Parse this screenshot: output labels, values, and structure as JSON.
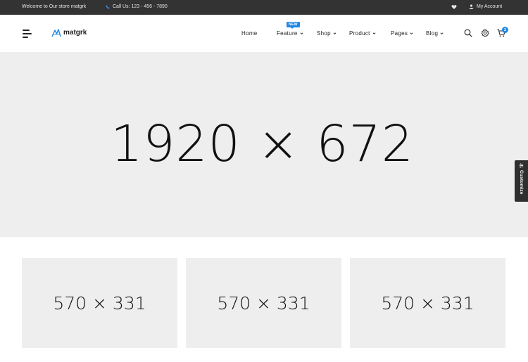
{
  "topbar": {
    "welcome": "Welcome to Our store matgrk",
    "phone": "Call Us: 123 - 456 - 7890",
    "account": "My Account"
  },
  "brand": {
    "name": "matgrk",
    "accent": "#1e88e5"
  },
  "nav": {
    "home": "Home",
    "feature": "Feature",
    "feature_badge": "NEW",
    "shop": "Shop",
    "product": "Product",
    "pages": "Pages",
    "blog": "Blog"
  },
  "cart": {
    "count": "2"
  },
  "icons": [
    "menu-icon",
    "search-icon",
    "gear-icon",
    "cart-icon",
    "heart-icon",
    "user-icon",
    "phone-icon",
    "chevron-down-icon",
    "sliders-icon"
  ],
  "hero": {
    "placeholder": "1920 × 672"
  },
  "customize": {
    "label": "Customize"
  },
  "banners": [
    {
      "placeholder": "570 × 331"
    },
    {
      "placeholder": "570 × 331"
    },
    {
      "placeholder": "570 × 331"
    }
  ]
}
